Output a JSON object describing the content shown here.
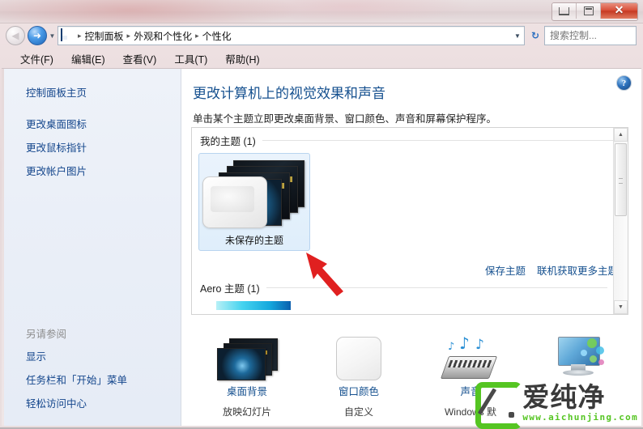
{
  "window": {
    "titlebar_text": "",
    "controls": {
      "minimize": "—",
      "maximize": "❐",
      "close": "✕"
    }
  },
  "nav": {
    "back_tooltip": "后退",
    "forward_tooltip": "前进",
    "history_caret": "▼",
    "breadcrumbs": [
      "控制面板",
      "外观和个性化",
      "个性化"
    ],
    "separator": "▸",
    "dropdown_caret": "▼",
    "refresh_glyph": "↻",
    "search_placeholder": "搜索控制...",
    "search_value": "",
    "search_icon": "🔍"
  },
  "menubar": {
    "items": [
      "文件(F)",
      "编辑(E)",
      "查看(V)",
      "工具(T)",
      "帮助(H)"
    ]
  },
  "sidebar": {
    "home": "控制面板主页",
    "links": [
      "更改桌面图标",
      "更改鼠标指针",
      "更改帐户图片"
    ],
    "see_also_header": "另请参阅",
    "see_also_links": [
      "显示",
      "任务栏和「开始」菜单",
      "轻松访问中心"
    ]
  },
  "main": {
    "help_glyph": "?",
    "title": "更改计算机上的视觉效果和声音",
    "subtitle": "单击某个主题立即更改桌面背景、窗口颜色、声音和屏幕保护程序。",
    "groups": [
      {
        "label": "我的主题 (1)",
        "themes": [
          {
            "name": "未保存的主题",
            "selected": true
          }
        ]
      },
      {
        "label": "Aero 主题 (1)",
        "themes": []
      }
    ],
    "panel_links": [
      "保存主题",
      "联机获取更多主题"
    ],
    "scroll": {
      "up": "▲",
      "down": "▼"
    }
  },
  "bottom_items": [
    {
      "label": "桌面背景",
      "value": "放映幻灯片",
      "icon": "wallpaper-stack-icon"
    },
    {
      "label": "窗口颜色",
      "value": "自定义",
      "icon": "window-color-icon"
    },
    {
      "label": "声音",
      "value": "Windows 默",
      "icon": "sound-icon"
    },
    {
      "label": "",
      "value": "",
      "icon": "screensaver-monitor-icon"
    }
  ],
  "watermark": {
    "brand": "爱纯净",
    "url": "www.aichunjing.com"
  },
  "colors": {
    "link": "#15508f",
    "title": "#15508f",
    "accent_green": "#55c522",
    "selection": "#b8d4ef",
    "annotation_red": "#e02020"
  }
}
